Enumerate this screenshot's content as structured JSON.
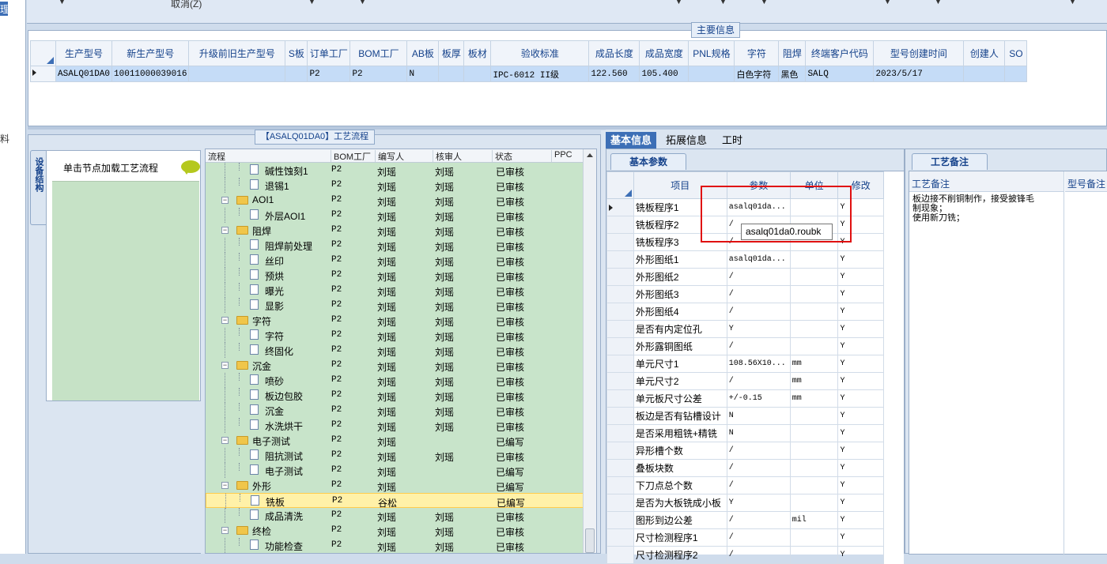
{
  "left_menu": {
    "item_top": "理",
    "item_mid": "料"
  },
  "toolbar": {
    "cancel_label": "取消(Z)"
  },
  "main_info": {
    "title": "主要信息",
    "columns": [
      "生产型号",
      "新生产型号",
      "升级前旧生产型号",
      "S板",
      "订单工厂",
      "BOM工厂",
      "AB板",
      "板厚",
      "板材",
      "验收标准",
      "成品长度",
      "成品宽度",
      "PNL规格",
      "字符",
      "阻焊",
      "终端客户代码",
      "型号创建时间",
      "创建人",
      "SO"
    ],
    "row": [
      "ASALQ01DA0",
      "10011000039016",
      "",
      "",
      "P2",
      "P2",
      "N",
      "",
      "",
      "IPC-6012 II级",
      "122.560",
      "105.400",
      "",
      "白色字符",
      "黑色",
      "SALQ",
      "2023/5/17",
      "",
      ""
    ]
  },
  "process": {
    "title": "【ASALQ01DA0】工艺流程",
    "vertical_tab": "设备结构",
    "load_hint": "单击节点加载工艺流程",
    "columns": [
      "流程",
      "BOM工厂",
      "编写人",
      "核审人",
      "状态",
      "PPC"
    ],
    "rows": [
      {
        "name": "碱性蚀刻1",
        "level": 2,
        "factory": "P2",
        "writer": "刘瑶",
        "reviewer": "刘瑶",
        "status": "已审核"
      },
      {
        "name": "退锡1",
        "level": 2,
        "factory": "P2",
        "writer": "刘瑶",
        "reviewer": "刘瑶",
        "status": "已审核"
      },
      {
        "name": "AOI1",
        "level": 1,
        "factory": "P2",
        "writer": "刘瑶",
        "reviewer": "刘瑶",
        "status": "已审核"
      },
      {
        "name": "外层AOI1",
        "level": 2,
        "factory": "P2",
        "writer": "刘瑶",
        "reviewer": "刘瑶",
        "status": "已审核"
      },
      {
        "name": "阻焊",
        "level": 1,
        "factory": "P2",
        "writer": "刘瑶",
        "reviewer": "刘瑶",
        "status": "已审核"
      },
      {
        "name": "阻焊前处理",
        "level": 2,
        "factory": "P2",
        "writer": "刘瑶",
        "reviewer": "刘瑶",
        "status": "已审核"
      },
      {
        "name": "丝印",
        "level": 2,
        "factory": "P2",
        "writer": "刘瑶",
        "reviewer": "刘瑶",
        "status": "已审核"
      },
      {
        "name": "预烘",
        "level": 2,
        "factory": "P2",
        "writer": "刘瑶",
        "reviewer": "刘瑶",
        "status": "已审核"
      },
      {
        "name": "曝光",
        "level": 2,
        "factory": "P2",
        "writer": "刘瑶",
        "reviewer": "刘瑶",
        "status": "已审核"
      },
      {
        "name": "显影",
        "level": 2,
        "factory": "P2",
        "writer": "刘瑶",
        "reviewer": "刘瑶",
        "status": "已审核"
      },
      {
        "name": "字符",
        "level": 1,
        "factory": "P2",
        "writer": "刘瑶",
        "reviewer": "刘瑶",
        "status": "已审核"
      },
      {
        "name": "字符",
        "level": 2,
        "factory": "P2",
        "writer": "刘瑶",
        "reviewer": "刘瑶",
        "status": "已审核"
      },
      {
        "name": "终固化",
        "level": 2,
        "factory": "P2",
        "writer": "刘瑶",
        "reviewer": "刘瑶",
        "status": "已审核"
      },
      {
        "name": "沉金",
        "level": 1,
        "factory": "P2",
        "writer": "刘瑶",
        "reviewer": "刘瑶",
        "status": "已审核"
      },
      {
        "name": "喷砂",
        "level": 2,
        "factory": "P2",
        "writer": "刘瑶",
        "reviewer": "刘瑶",
        "status": "已审核"
      },
      {
        "name": "板边包胶",
        "level": 2,
        "factory": "P2",
        "writer": "刘瑶",
        "reviewer": "刘瑶",
        "status": "已审核"
      },
      {
        "name": "沉金",
        "level": 2,
        "factory": "P2",
        "writer": "刘瑶",
        "reviewer": "刘瑶",
        "status": "已审核"
      },
      {
        "name": "水洗烘干",
        "level": 2,
        "factory": "P2",
        "writer": "刘瑶",
        "reviewer": "刘瑶",
        "status": "已审核"
      },
      {
        "name": "电子测试",
        "level": 1,
        "factory": "P2",
        "writer": "刘瑶",
        "reviewer": "",
        "status": "已编写"
      },
      {
        "name": "阻抗测试",
        "level": 2,
        "factory": "P2",
        "writer": "刘瑶",
        "reviewer": "刘瑶",
        "status": "已审核"
      },
      {
        "name": "电子测试",
        "level": 2,
        "factory": "P2",
        "writer": "刘瑶",
        "reviewer": "",
        "status": "已编写"
      },
      {
        "name": "外形",
        "level": 1,
        "factory": "P2",
        "writer": "刘瑶",
        "reviewer": "",
        "status": "已编写"
      },
      {
        "name": "铣板",
        "level": 2,
        "factory": "P2",
        "writer": "谷松",
        "reviewer": "",
        "status": "已编写",
        "selected": true
      },
      {
        "name": "成品清洗",
        "level": 2,
        "factory": "P2",
        "writer": "刘瑶",
        "reviewer": "刘瑶",
        "status": "已审核"
      },
      {
        "name": "终检",
        "level": 1,
        "factory": "P2",
        "writer": "刘瑶",
        "reviewer": "刘瑶",
        "status": "已审核"
      },
      {
        "name": "功能检查",
        "level": 2,
        "factory": "P2",
        "writer": "刘瑶",
        "reviewer": "刘瑶",
        "status": "已审核"
      },
      {
        "name": "外观检查",
        "level": 2,
        "factory": "P2",
        "writer": "刘瑶",
        "reviewer": "刘瑶",
        "status": "已审核"
      }
    ]
  },
  "right_tabs": [
    "基本信息",
    "拓展信息",
    "工时"
  ],
  "basic_params": {
    "tab_label": "基本参数",
    "columns": [
      "项目",
      "参数",
      "单位",
      "修改"
    ],
    "rows": [
      [
        "铣板程序1",
        "asalq01da...",
        "",
        "Y"
      ],
      [
        "铣板程序2",
        "/",
        "",
        "Y"
      ],
      [
        "铣板程序3",
        "/",
        "",
        "Y"
      ],
      [
        "外形图纸1",
        "asalq01da...",
        "",
        "Y"
      ],
      [
        "外形图纸2",
        "/",
        "",
        "Y"
      ],
      [
        "外形图纸3",
        "/",
        "",
        "Y"
      ],
      [
        "外形图纸4",
        "/",
        "",
        "Y"
      ],
      [
        "是否有内定位孔",
        "Y",
        "",
        "Y"
      ],
      [
        "外形露铜图纸",
        "/",
        "",
        "Y"
      ],
      [
        "单元尺寸1",
        "108.56X10...",
        "mm",
        "Y"
      ],
      [
        "单元尺寸2",
        "/",
        "mm",
        "Y"
      ],
      [
        "单元板尺寸公差",
        "+/-0.15",
        "mm",
        "Y"
      ],
      [
        "板边是否有钻槽设计",
        "N",
        "",
        "Y"
      ],
      [
        "是否采用粗铣+精铣",
        "N",
        "",
        "Y"
      ],
      [
        "异形槽个数",
        "/",
        "",
        "Y"
      ],
      [
        "叠板块数",
        "/",
        "",
        "Y"
      ],
      [
        "下刀点总个数",
        "/",
        "",
        "Y"
      ],
      [
        "是否为大板铣成小板",
        "Y",
        "",
        "Y"
      ],
      [
        "图形到边公差",
        "/",
        "mil",
        "Y"
      ],
      [
        "尺寸检测程序1",
        "/",
        "",
        "Y"
      ],
      [
        "尺寸检测程序2",
        "/",
        "",
        "Y"
      ]
    ],
    "tooltip": "asalq01da0.roubk"
  },
  "notes": {
    "tab_label": "工艺备注",
    "col1": "工艺备注",
    "col2": "型号备注",
    "lines": [
      "板边接不削铜制作，接受披锋毛",
      "制现象；",
      "使用新刀铣；"
    ]
  },
  "colors": {
    "selected_tab": "#3d6fb6",
    "highlight_box": "#e01010",
    "tree_bg": "#c8e4ca",
    "selected_row": "#fff1a8"
  }
}
